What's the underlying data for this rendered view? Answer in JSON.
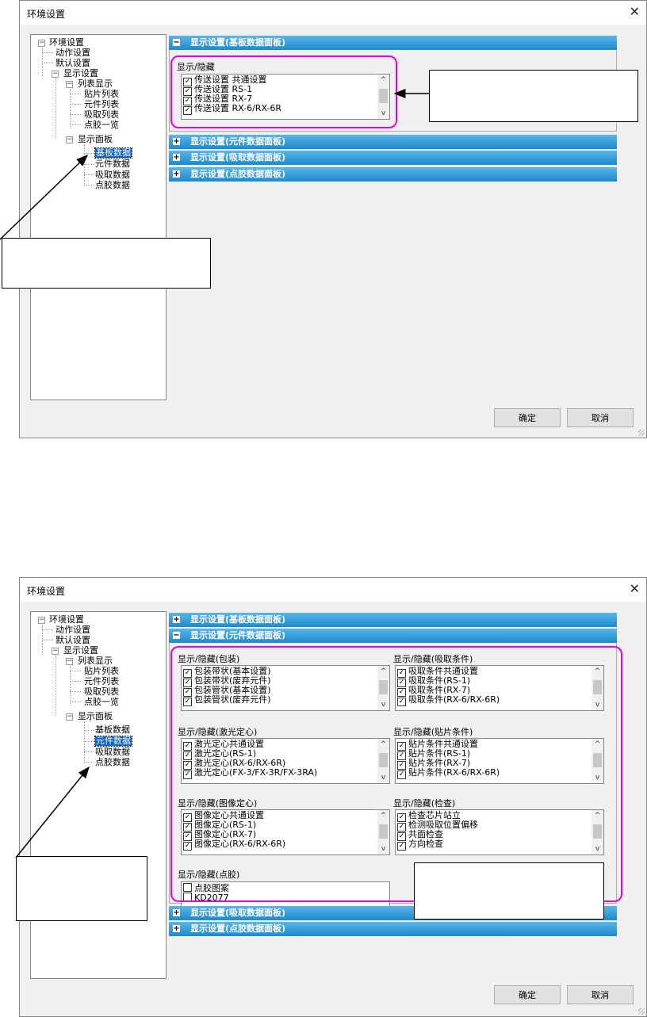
{
  "dialog_title": "环境设置",
  "close_glyph": "✕",
  "buttons": {
    "ok": "确定",
    "cancel": "取消"
  },
  "tree": {
    "root": "环境设置",
    "action": "动作设置",
    "default": "默认设置",
    "display": "显示设置",
    "list_display": "列表显示",
    "list_mount": "贴片列表",
    "list_component": "元件列表",
    "list_pickup": "吸取列表",
    "list_dispense": "点胶一览",
    "display_panel": "显示面板",
    "board_data": "基板数据",
    "component_data": "元件数据",
    "pickup_data": "吸取数据",
    "dispense_data": "点胶数据"
  },
  "panels": {
    "board": "显示设置(基板数据面板)",
    "component": "显示设置(元件数据面板)",
    "pickup": "显示设置(吸取数据面板)",
    "dispense": "显示设置(点胶数据面板)"
  },
  "expand_glyph": "+",
  "collapse_glyph": "−",
  "screen1": {
    "group_label": "显示/隐藏",
    "items": [
      "传送设置 共通设置",
      "传送设置 RS-1",
      "传送设置 RX-7",
      "传送设置 RX-6/RX-6R"
    ]
  },
  "screen2": {
    "groups": {
      "package": {
        "label": "显示/隐藏(包装)",
        "items": [
          "包装带状(基本设置)",
          "包装带状(废弃元件)",
          "包装管状(基本设置)",
          "包装管状(废弃元件)"
        ]
      },
      "pickup": {
        "label": "显示/隐藏(吸取条件)",
        "items": [
          "吸取条件共通设置",
          "吸取条件(RS-1)",
          "吸取条件(RX-7)",
          "吸取条件(RX-6/RX-6R)"
        ]
      },
      "laser": {
        "label": "显示/隐藏(激光定心)",
        "items": [
          "激光定心共通设置",
          "激光定心(RS-1)",
          "激光定心(RX-6/RX-6R)",
          "激光定心(FX-3/FX-3R/FX-3RA)"
        ]
      },
      "mount": {
        "label": "显示/隐藏(贴片条件)",
        "items": [
          "贴片条件共通设置",
          "贴片条件(RS-1)",
          "贴片条件(RX-7)",
          "贴片条件(RX-6/RX-6R)"
        ]
      },
      "vision": {
        "label": "显示/隐藏(图像定心)",
        "items": [
          "图像定心共通设置",
          "图像定心(RS-1)",
          "图像定心(RX-7)",
          "图像定心(RX-6/RX-6R)"
        ]
      },
      "inspect": {
        "label": "显示/隐藏(检查)",
        "items": [
          "检查芯片站立",
          "检测吸取位置偏移",
          "共面检查",
          "方向检查"
        ]
      },
      "dispense": {
        "label": "显示/隐藏(点胶)",
        "items": [
          "点胶图案",
          "KD2077"
        ]
      }
    }
  },
  "check_glyph": "✓",
  "scroll_up": "^",
  "scroll_down": "v",
  "colors": {
    "highlight": "#e600e6",
    "selection": "#0a64c8",
    "panel_bar": "#1c8acd"
  }
}
